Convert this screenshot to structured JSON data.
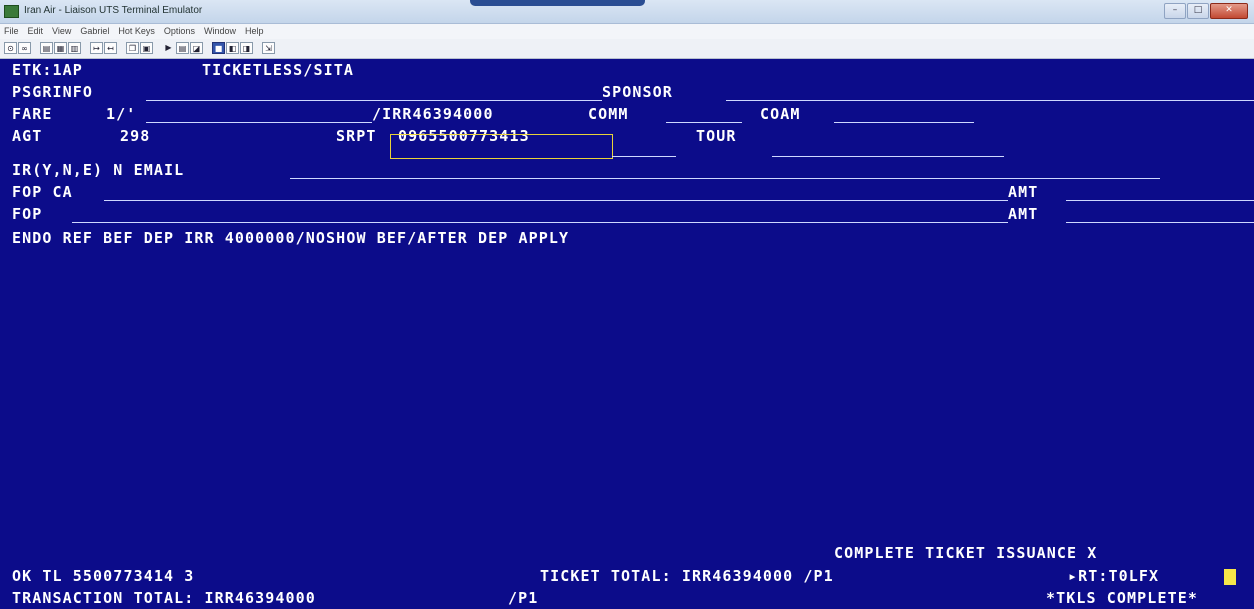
{
  "window": {
    "title": "Iran Air - Liaison UTS Terminal Emulator",
    "buttons": [
      "–",
      "□",
      "✕"
    ]
  },
  "menu": [
    "File",
    "Edit",
    "View",
    "Gabriel",
    "Hot Keys",
    "Options",
    "Window",
    "Help"
  ],
  "toolbar": [
    "connect-icon",
    "disconnect-icon",
    "print-icon",
    "print-screen-icon",
    "print-setup-icon",
    "send-icon",
    "receive-icon",
    "copy-icon",
    "paste-icon",
    "play-icon",
    "print-icon",
    "capture-icon",
    "window-icon",
    "split-left-icon",
    "split-right-icon",
    "exit-icon"
  ],
  "terminal": {
    "etk": "ETK:1AP",
    "ticketless": "TICKETLESS/SITA",
    "psginfo": "PSGRINFO",
    "sponsor": "SPONSOR",
    "fare_label": "FARE",
    "fare_value": "1/'",
    "fare_amount": "/IRR46394000",
    "comm": "COMM",
    "coam": "COAM",
    "agt_label": "AGT",
    "agt_value": "298",
    "srpt_label": "SRPT",
    "srpt_value": "0965500773413",
    "tour": "TOUR",
    "ir_email": "IR(Y,N,E) N EMAIL",
    "fop1": "FOP CA",
    "amt1": "AMT",
    "fop2": "FOP",
    "amt2": "AMT",
    "endo": "ENDO REF BEF DEP IRR 4000000/NOSHOW BEF/AFTER DEP APPLY",
    "complete_issuance": "COMPLETE TICKET ISSUANCE X",
    "ok_tl": "OK TL 5500773414 3",
    "ticket_total": "TICKET TOTAL: IRR46394000 /P1",
    "rt": "▸RT:T0LFX",
    "transaction_total": "TRANSACTION TOTAL: IRR46394000",
    "p1": "/P1",
    "tkls_complete": "*TKLS COMPLETE*"
  },
  "colors": {
    "screen_bg": "#0c0c8a",
    "text": "#ffffff",
    "highlight": "#e8d23a",
    "cursor": "#f6e64a"
  }
}
